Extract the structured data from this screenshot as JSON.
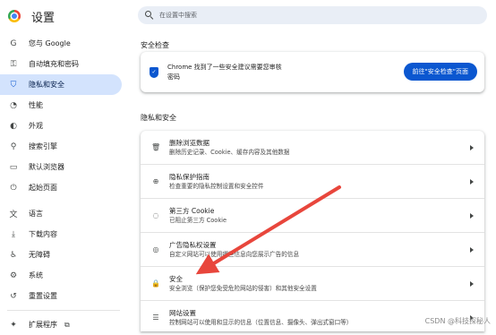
{
  "app": {
    "title": "设置"
  },
  "search": {
    "placeholder": "在设置中搜索"
  },
  "sidebar": {
    "items": [
      {
        "label": "您与 Google",
        "icon": "google-icon",
        "glyph": "G"
      },
      {
        "label": "自动填充和密码",
        "icon": "key-icon",
        "glyph": "⚿"
      },
      {
        "label": "隐私和安全",
        "icon": "shield-icon",
        "glyph": "⛉",
        "active": true
      },
      {
        "label": "性能",
        "icon": "speedometer-icon",
        "glyph": "◔"
      },
      {
        "label": "外观",
        "icon": "palette-icon",
        "glyph": "◐"
      },
      {
        "label": "搜索引擎",
        "icon": "search-icon",
        "glyph": "⚲"
      },
      {
        "label": "默认浏览器",
        "icon": "browser-icon",
        "glyph": "▭"
      },
      {
        "label": "起始页面",
        "icon": "power-icon",
        "glyph": "⏻"
      },
      {
        "label": "语言",
        "icon": "translate-icon",
        "glyph": "文"
      },
      {
        "label": "下载内容",
        "icon": "download-icon",
        "glyph": "⤓"
      },
      {
        "label": "无障碍",
        "icon": "accessibility-icon",
        "glyph": "♿"
      },
      {
        "label": "系统",
        "icon": "wrench-icon",
        "glyph": "⚙"
      },
      {
        "label": "重置设置",
        "icon": "reset-icon",
        "glyph": "↺"
      },
      {
        "label": "扩展程序",
        "icon": "extension-icon",
        "glyph": "✦"
      }
    ]
  },
  "safety_check": {
    "section_title": "安全检查",
    "line1": "Chrome 找到了一些安全建议需要您审核",
    "line2": "密码",
    "button_label": "前往\"安全检查\"页面"
  },
  "privacy": {
    "section_title": "隐私和安全",
    "rows": [
      {
        "title": "删除浏览数据",
        "subtitle": "删除历史记录、Cookie、缓存内容及其他数据",
        "icon": "trash-icon",
        "glyph": "🗑"
      },
      {
        "title": "隐私保护指南",
        "subtitle": "检查重要的隐私控制设置和安全控件",
        "icon": "guide-icon",
        "glyph": "⊕"
      },
      {
        "title": "第三方 Cookie",
        "subtitle": "已阻止第三方 Cookie",
        "icon": "cookie-icon",
        "glyph": "◌"
      },
      {
        "title": "广告隐私权设置",
        "subtitle": "自定义网站可以使用哪些信息向您展示广告的信息",
        "icon": "ad-privacy-icon",
        "glyph": "◎"
      },
      {
        "title": "安全",
        "subtitle": "安全浏览（保护您免受危险网站的侵害）和其他安全设置",
        "icon": "lock-icon",
        "glyph": "🔒"
      },
      {
        "title": "网站设置",
        "subtitle": "控制网站可以使用和显示的信息（位置信息、摄像头、弹出式窗口等）",
        "icon": "site-settings-icon",
        "glyph": "☰"
      }
    ]
  },
  "colors": {
    "accent": "#0b57d0",
    "active_bg": "#d3e3fd",
    "arrow": "#e8463c"
  },
  "watermark": "CSDN @科技探秘人"
}
